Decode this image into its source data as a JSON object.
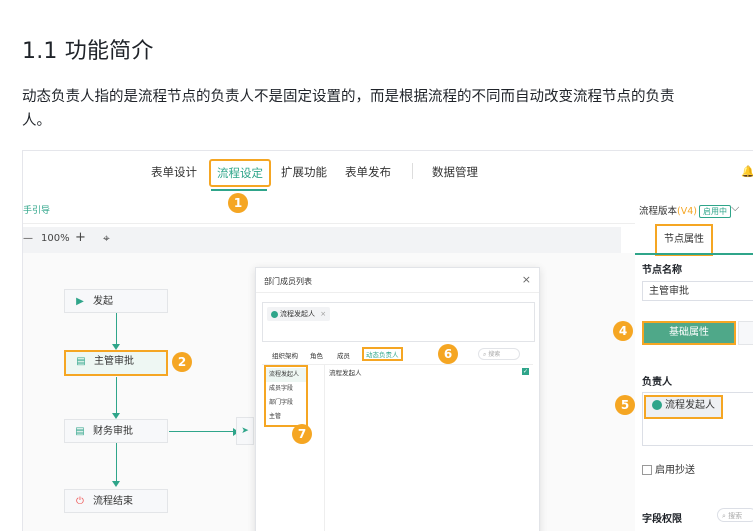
{
  "heading": "1.1 功能简介",
  "paragraph": "动态负责人指的是流程节点的负责人不是固定设置的，而是根据流程的不同而自动改变流程节点的负责人。",
  "screenshot": {
    "nav_tabs": [
      "表单设计",
      "流程设定",
      "扩展功能",
      "表单发布",
      "数据管理"
    ],
    "active_tab": "流程设定",
    "guide_text": "手引导",
    "version_label": "流程版本",
    "version_value": "(V4)",
    "version_tag": "启用中",
    "zoom": {
      "minus": "—",
      "level": "100%",
      "plus": "+"
    },
    "nodes": [
      "发起",
      "主管审批",
      "财务审批",
      "流程结束"
    ],
    "modal": {
      "title": "部门成员列表",
      "close": "×",
      "chip": "流程发起人",
      "chip_close": "×",
      "tabs": [
        "组织架构",
        "角色",
        "成员",
        "动态负责人"
      ],
      "search_placeholder": "搜索",
      "left_items": [
        "流程发起人",
        "成员字段",
        "部门字段",
        "主管"
      ],
      "right_item": "流程发起人",
      "check": "✓"
    },
    "right_panel": {
      "tab": "节点属性",
      "node_name_label": "节点名称",
      "node_name_value": "主管审批",
      "basic_tab": "基础属性",
      "owner_label": "负责人",
      "owner_value": "流程发起人",
      "cc_label": "启用抄送",
      "field_label": "字段权限",
      "field_search": "搜索"
    },
    "badges": [
      "1",
      "2",
      "4",
      "5",
      "6",
      "7"
    ]
  }
}
